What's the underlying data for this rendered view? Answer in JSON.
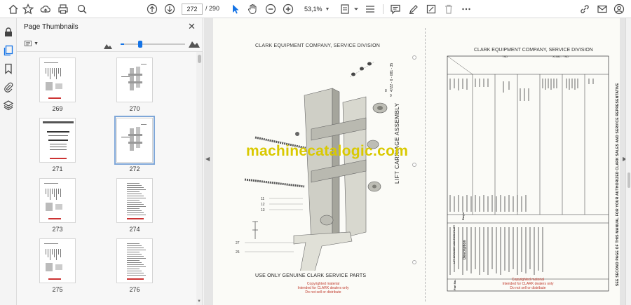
{
  "toolbar": {
    "current_page": "272",
    "total_pages": "/ 290",
    "zoom": "53,1%"
  },
  "panel": {
    "title": "Page Thumbnails",
    "zoom_level": 0.05
  },
  "thumbnails": [
    {
      "label": "269",
      "selected": false,
      "kind": "parts-list"
    },
    {
      "label": "270",
      "selected": false,
      "kind": "diagram"
    },
    {
      "label": "271",
      "selected": false,
      "kind": "title"
    },
    {
      "label": "272",
      "selected": true,
      "kind": "diagram"
    },
    {
      "label": "273",
      "selected": false,
      "kind": "parts-list"
    },
    {
      "label": "274",
      "selected": false,
      "kind": "table"
    },
    {
      "label": "275",
      "selected": false,
      "kind": "parts-list"
    },
    {
      "label": "276",
      "selected": false,
      "kind": "table"
    }
  ],
  "document": {
    "left_header": "CLARK EQUIPMENT COMPANY, SERVICE DIVISION",
    "left_footer": "USE ONLY GENUINE CLARK SERVICE PARTS",
    "left_side_title": "LIFT CARRIAGE ASSEMBLY",
    "left_code": "4722 - 6 - 081 - 35",
    "right_header": "CLARK EQUIPMENT COMPANY, SERVICE DIVISION",
    "right_model": "TSD",
    "right_code": "X1081 - TSD",
    "right_side_text": "SEE SECOND PAGE OF THIS MANUAL FOR YOUR AUTHORIZED CLARK SALES AND SERVICE REPRESENTATIVE",
    "table_heading": "Description",
    "table_subheading": "LIFT BRACKET AND FORK PLATE",
    "table_col_req": "Req'd",
    "table_col_part": "Part No.",
    "watermark": "machinecatalogic.com",
    "copyright_lines": [
      "Copyrighted material",
      "Intended for CLARK dealers only",
      "Do not sell or distribute"
    ]
  }
}
